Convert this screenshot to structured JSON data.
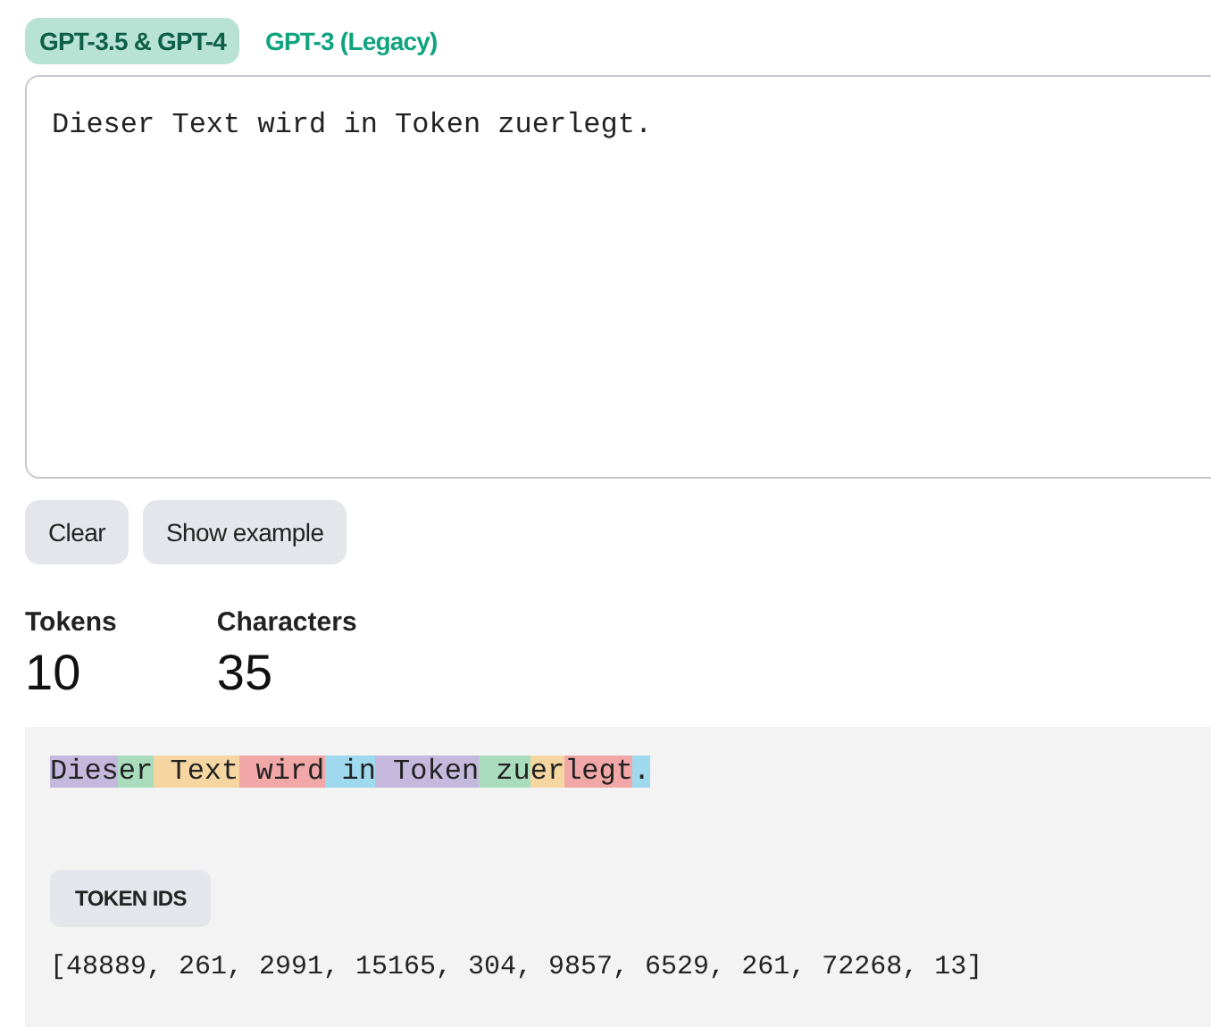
{
  "tabs": [
    {
      "label": "GPT-3.5 & GPT-4",
      "selected": true
    },
    {
      "label": "GPT-3 (Legacy)",
      "selected": false
    }
  ],
  "input": {
    "value": "Dieser Text wird in Token zuerlegt."
  },
  "buttons": [
    "Clear",
    "Show example"
  ],
  "stats": [
    {
      "label": "Tokens",
      "value": "10"
    },
    {
      "label": "Characters",
      "value": "35"
    }
  ],
  "tokens": [
    {
      "text": "Dies",
      "color": "#c5b8dd"
    },
    {
      "text": "er",
      "color": "#a9dcbd"
    },
    {
      "text": " Text",
      "color": "#f5d5a0"
    },
    {
      "text": " wird",
      "color": "#f1a7a7"
    },
    {
      "text": " in",
      "color": "#9fd9ee"
    },
    {
      "text": " Token",
      "color": "#c5b8dd"
    },
    {
      "text": " zu",
      "color": "#a9dcbd"
    },
    {
      "text": "er",
      "color": "#f5d5a0"
    },
    {
      "text": "legt",
      "color": "#f1a7a7"
    },
    {
      "text": ".",
      "color": "#9fd9ee"
    }
  ],
  "view_toggle": {
    "label": "TOKEN IDS"
  },
  "token_ids": "[48889, 261, 2991, 15165, 304, 9857, 6529, 261, 72268, 13]"
}
